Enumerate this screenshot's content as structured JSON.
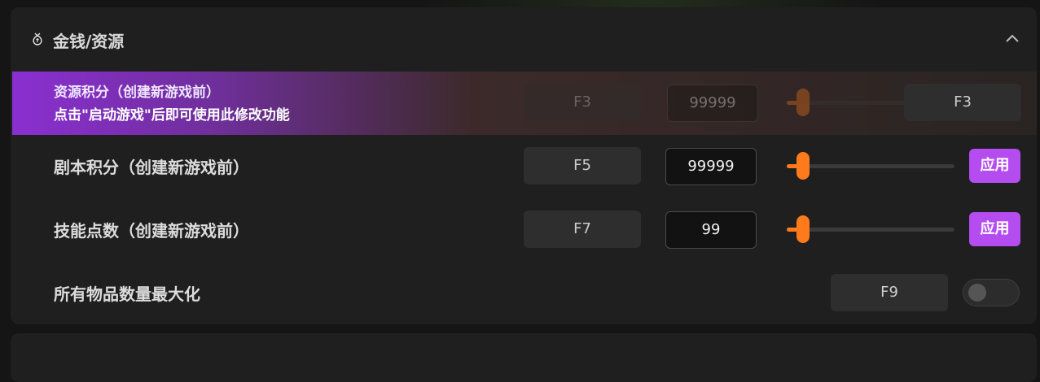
{
  "section": {
    "title": "金钱/资源",
    "icon": "money-bag-icon",
    "collapse_icon": "chevron-up-icon"
  },
  "rows": [
    {
      "label": "资源积分（创建新游戏前）",
      "notice": "点击\"启动游戏\"后即可使用此修改功能",
      "hotkey_dim": "F3",
      "value": "99999",
      "hotkey": "F3",
      "slider_level": 0.1
    },
    {
      "label": "剧本积分（创建新游戏前）",
      "hotkey": "F5",
      "value": "99999",
      "slider_level": 0.1,
      "apply": "应用"
    },
    {
      "label": "技能点数（创建新游戏前）",
      "hotkey": "F7",
      "value": "99",
      "slider_level": 0.1,
      "apply": "应用"
    },
    {
      "label": "所有物品数量最大化",
      "hotkey": "F9",
      "toggle_on": false
    }
  ],
  "colors": {
    "accent": "#b44cf0",
    "slider": "#ff7a1a",
    "panel": "#1f1f1f"
  }
}
